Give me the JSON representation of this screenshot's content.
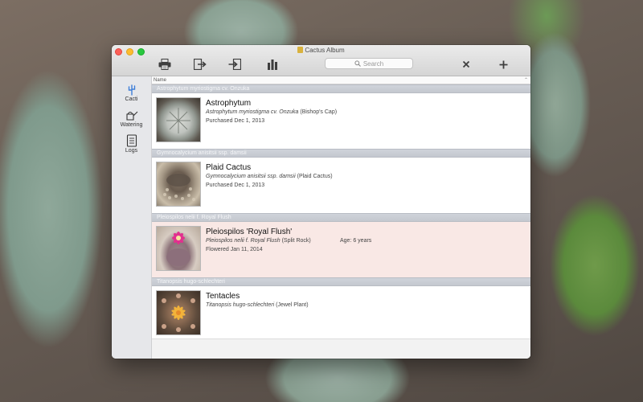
{
  "window": {
    "title": "Cactus Album"
  },
  "toolbar": {
    "buttons": [
      {
        "icon": "printer-icon"
      },
      {
        "icon": "export-icon"
      },
      {
        "icon": "import-icon"
      },
      {
        "icon": "stats-icon"
      },
      {
        "icon": "close-icon"
      },
      {
        "icon": "plus-icon"
      }
    ],
    "search": {
      "placeholder": "Search"
    }
  },
  "sidebar": {
    "items": [
      {
        "label": "Cacti",
        "icon": "cactus-icon",
        "active": true
      },
      {
        "label": "Watering",
        "icon": "watering-can-icon"
      },
      {
        "label": "Logs",
        "icon": "logs-icon"
      }
    ]
  },
  "list": {
    "column_header": "Name",
    "sections": [
      {
        "header": "Astrophytum myriostigma cv. Onzuka",
        "entry": {
          "name": "Astrophytum",
          "scientific": "Astrophytum myriostigma cv. Onzuka",
          "common": "(Bishop's Cap)",
          "date": "Purchased Dec 1, 2013",
          "age": "",
          "selected": false
        }
      },
      {
        "header": "Gymnocalycium anisitsii ssp. damsii",
        "entry": {
          "name": "Plaid Cactus",
          "scientific": "Gymnocalycium anisitsii ssp. damsii",
          "common": "(Plaid Cactus)",
          "date": "Purchased Dec 1, 2013",
          "age": "",
          "selected": false
        }
      },
      {
        "header": "Pleiospilos nelii f. Royal Flush",
        "entry": {
          "name": "Pleiospilos 'Royal Flush'",
          "scientific": "Pleiospilos nelii f. Royal Flush",
          "common": "(Split Rock)",
          "date": "Flowered Jan 11, 2014",
          "age": "Age: 6 years",
          "selected": true
        }
      },
      {
        "header": "Titanopsis hugo-schlechteri",
        "entry": {
          "name": "Tentacles",
          "scientific": "Titanopsis hugo-schlechteri",
          "common": "(Jewel Plant)",
          "date": "",
          "age": "",
          "selected": false
        }
      }
    ]
  },
  "colors": {
    "selected_row": "#f9e8e5",
    "section_header": "#c8ccd3",
    "sidebar_accent": "#3d7ed8"
  }
}
